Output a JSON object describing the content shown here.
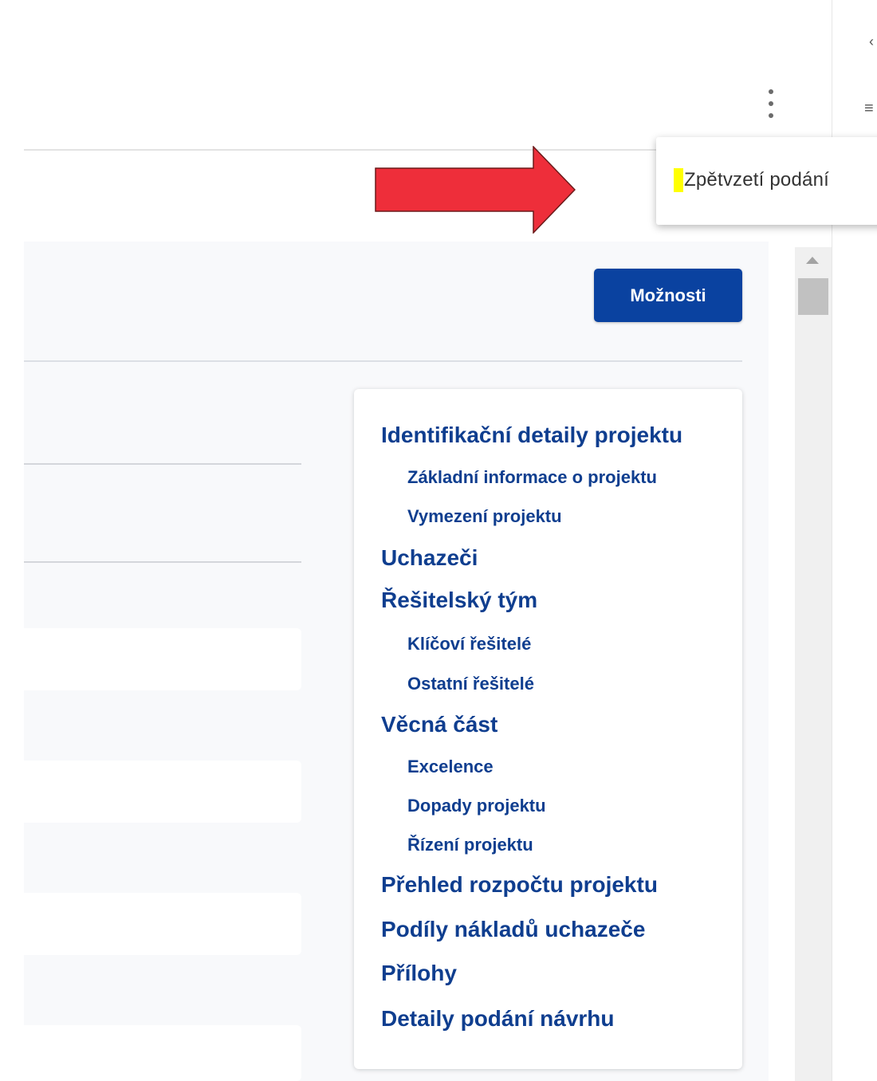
{
  "dropdown": {
    "items": [
      {
        "label": "Zpětvzetí podání"
      }
    ]
  },
  "toolbar": {
    "options_label": "Možnosti"
  },
  "toc": {
    "items": [
      {
        "label": "Identifikační detaily projektu",
        "level": 1
      },
      {
        "label": "Základní informace o projektu",
        "level": 2
      },
      {
        "label": "Vymezení projektu",
        "level": 2
      },
      {
        "label": "Uchazeči",
        "level": 1
      },
      {
        "label": "Řešitelský tým",
        "level": 1
      },
      {
        "label": "Klíčoví řešitelé",
        "level": 2
      },
      {
        "label": "Ostatní řešitelé",
        "level": 2
      },
      {
        "label": "Věcná část",
        "level": 1
      },
      {
        "label": "Excelence",
        "level": 2
      },
      {
        "label": "Dopady projektu",
        "level": 2
      },
      {
        "label": "Řízení projektu",
        "level": 2
      },
      {
        "label": "Přehled rozpočtu projektu",
        "level": 1
      },
      {
        "label": "Podíly nákladů uchazeče",
        "level": 1
      },
      {
        "label": "Přílohy",
        "level": 1
      },
      {
        "label": "Detaily podání návrhu",
        "level": 1
      }
    ]
  },
  "icons": {
    "more": "more-vert-icon",
    "rail_top": "chevron-left-icon",
    "rail_menu": "menu-icon",
    "arrow": "red-arrow-icon",
    "highlight": "highlight-marker"
  },
  "colors": {
    "primary": "#0a42a0",
    "link": "#0f3e8f",
    "arrow": "#ee2e3a",
    "highlight": "#ffff00"
  }
}
